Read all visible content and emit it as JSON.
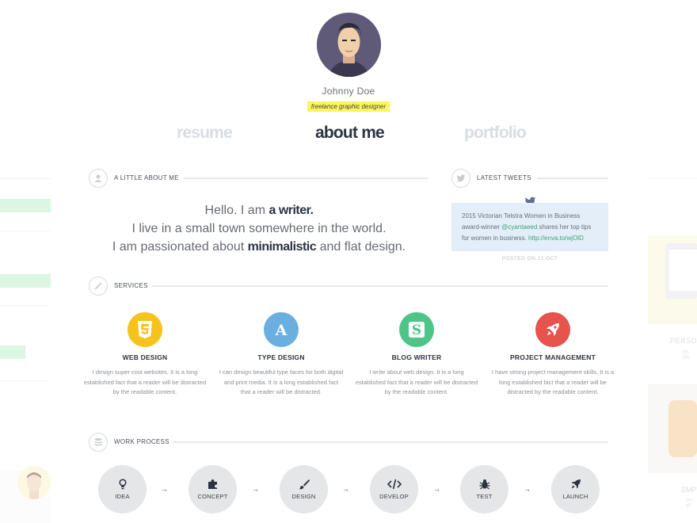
{
  "profile": {
    "name": "Johnny Doe",
    "role": "freelance graphic designer"
  },
  "nav": {
    "resume": "resume",
    "about": "about me",
    "portfolio": "portfolio"
  },
  "about": {
    "heading": "A LITTLE ABOUT ME",
    "line1_prefix": "Hello. I am ",
    "line1_bold": "a writer.",
    "line2": "I live in a small town somewhere in the world.",
    "line3_prefix": "I am passionated about ",
    "line3_bold": "minimalistic",
    "line3_suffix": " and flat design."
  },
  "tweets": {
    "heading": "LATEST TWEETS",
    "text_part1": "2015 Victorian Telstra Women in Business award-winner ",
    "mention": "@cyantaeed",
    "text_part2": " shares her top tips for women in business. ",
    "link": "http://enva.to/wjOlD",
    "posted": "POSTED ON 22 OCT"
  },
  "services": {
    "heading": "SERVICES",
    "items": [
      {
        "icon": "html5-icon",
        "color": "#f5c31c",
        "title": "WEB DESIGN",
        "text": "I design super cool websites. It is a long established fact that a reader will be distracted by the readable content."
      },
      {
        "icon": "letter-a-icon",
        "color": "#6baee0",
        "title": "TYPE DESIGN",
        "text": "I can design beautiful type faces for both digital and print media. It is a long established fact that a reader will be distracted."
      },
      {
        "icon": "blog-s-icon",
        "color": "#4fc487",
        "title": "BLOG WRITER",
        "text": "I write about web design. It is a long established fact that a reader will be distracted by the readable content."
      },
      {
        "icon": "rocket-icon",
        "color": "#e7534d",
        "title": "PROJECT MANAGEMENT",
        "text": "I have strong project management skills. It is a long established fact that a reader will be distracted by the readable content."
      }
    ]
  },
  "process": {
    "heading": "WORK PROCESS",
    "steps": [
      "IDEA",
      "CONCEPT",
      "DESIGN",
      "DEVELOP",
      "TEST",
      "LAUNCH"
    ],
    "arrow": "→"
  },
  "ghost": {
    "card1_caption": "PERSONA",
    "card1_sub": "on Illu",
    "card2_caption": "EMPT",
    "card2_sub": "on W"
  },
  "colors": {
    "highlight": "#fdf55d",
    "accent_green": "#3aa679",
    "tweet_bg": "#e3eef8",
    "dark": "#2c3342"
  }
}
